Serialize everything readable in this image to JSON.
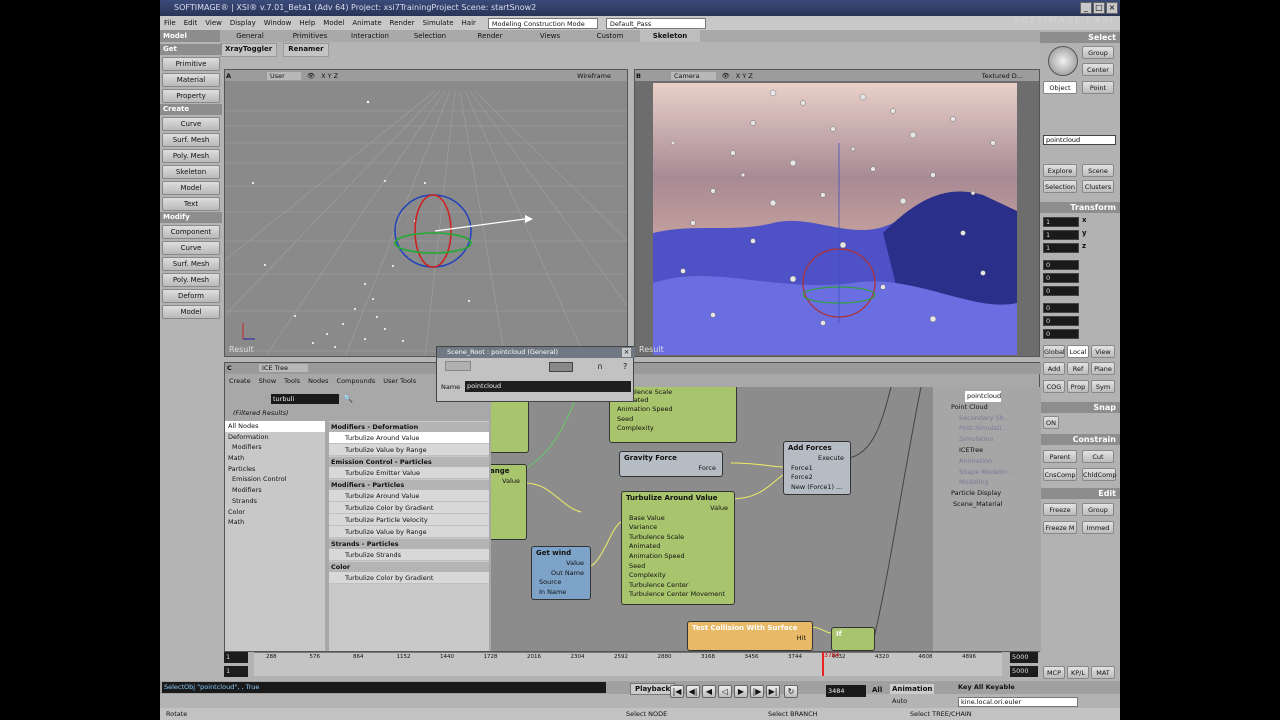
{
  "window": {
    "title": "SOFTIMAGE® | XSI® v.7.01_Beta1 (Adv 64) Project: xsi7TrainingProject     Scene: startSnow2",
    "brand": "SOFTIMAGE | XSI"
  },
  "menu": {
    "items": [
      "File",
      "Edit",
      "View",
      "Display",
      "Window",
      "Help",
      "Model",
      "Animate",
      "Render",
      "Simulate",
      "Hair"
    ],
    "layout": "Modeling Construction Mode",
    "pass": "Default_Pass"
  },
  "toptabs": {
    "mode": "Model",
    "tabs": [
      "General",
      "Primitives",
      "Interaction",
      "Selection",
      "Render",
      "Views",
      "Custom",
      "Skeleton"
    ]
  },
  "toolbar2": [
    "XrayToggler",
    "Renamer"
  ],
  "left": {
    "get": "Get",
    "get_items": [
      "Primitive",
      "Material",
      "Property"
    ],
    "create": "Create",
    "create_items": [
      "Curve",
      "Surf. Mesh",
      "Poly. Mesh",
      "Skeleton",
      "Model",
      "Text"
    ],
    "modify": "Modify",
    "modify_items": [
      "Component",
      "Curve",
      "Surf. Mesh",
      "Poly. Mesh",
      "Deform",
      "Model"
    ]
  },
  "vp1": {
    "letter": "A",
    "camera": "User",
    "axes": "X Y Z",
    "mode": "Wireframe",
    "result": "Result"
  },
  "vp2": {
    "letter": "B",
    "camera": "Camera",
    "axes": "X Y Z",
    "mode": "Textured D...",
    "result": "Result"
  },
  "right": {
    "select": "Select",
    "group": "Group",
    "center": "Center",
    "object": "Object",
    "point": "Point",
    "field": "pointcloud",
    "explore": "Explore",
    "scene": "Scene",
    "selection": "Selection",
    "clusters": "Clusters",
    "transform": "Transform",
    "axes": [
      "x",
      "y",
      "z"
    ],
    "scale_vals": [
      "1",
      "1",
      "1"
    ],
    "rot_vals": [
      "0",
      "0",
      "0"
    ],
    "trans_vals": [
      "0",
      "0",
      "0"
    ],
    "global": "Global",
    "local": "Local",
    "view": "View",
    "add": "Add",
    "ref": "Ref",
    "plane": "Plane",
    "cog": "COG",
    "prop": "Prop",
    "sym": "Sym",
    "snap": "Snap",
    "on": "ON",
    "constrain": "Constrain",
    "parent": "Parent",
    "cut": "Cut",
    "cnscomp": "CnsComp",
    "childcomp": "ChldComp",
    "edit": "Edit",
    "freeze": "Freeze",
    "egroup": "Group",
    "freezem": "Freeze M",
    "immed": "Immed"
  },
  "ice": {
    "letter": "C",
    "title": "ICE Tree",
    "menu": [
      "Create",
      "Show",
      "Tools",
      "Nodes",
      "Compounds",
      "User Tools"
    ],
    "search": "turbuli",
    "filtered": "(Filtered Results)",
    "cats": [
      {
        "label": "All Nodes",
        "sub": false,
        "sel": true
      },
      {
        "label": "Deformation",
        "sub": false,
        "sel": false
      },
      {
        "label": "Modifiers",
        "sub": true,
        "sel": false
      },
      {
        "label": "Math",
        "sub": false,
        "sel": false
      },
      {
        "label": "Particles",
        "sub": false,
        "sel": false
      },
      {
        "label": "Emission Control",
        "sub": true,
        "sel": false
      },
      {
        "label": "Modifiers",
        "sub": true,
        "sel": false
      },
      {
        "label": "Strands",
        "sub": true,
        "sel": false
      },
      {
        "label": "Color",
        "sub": false,
        "sel": false
      },
      {
        "label": "Math",
        "sub": false,
        "sel": false
      }
    ],
    "groups": [
      {
        "head": "Modifiers - Deformation",
        "items": [
          "Turbulize Around Value",
          "Turbulize Value by Range"
        ]
      },
      {
        "head": "Emission Control - Particles",
        "items": [
          "Turbulize Emitter Value"
        ]
      },
      {
        "head": "Modifiers - Particles",
        "items": [
          "Turbulize Around Value",
          "Turbulize Color by Gradient",
          "Turbulize Particle Velocity",
          "Turbulize Value by Range"
        ]
      },
      {
        "head": "Strands - Particles",
        "items": [
          "Turbulize Strands"
        ]
      },
      {
        "head": "Color",
        "items": [
          "Turbulize Color by Gradient"
        ]
      }
    ],
    "nodes": {
      "top": {
        "ports": [
          "Turbulence Scale",
          "Animated",
          "Animation Speed",
          "Seed",
          "Complexity"
        ]
      },
      "range": {
        "title": "ange",
        "value": "Value"
      },
      "gravity": {
        "title": "Gravity Force",
        "out": "Force"
      },
      "add": {
        "title": "Add Forces",
        "exec": "Execute",
        "ports": [
          "Force1",
          "Force2",
          "New (Force1) ..."
        ]
      },
      "turb": {
        "title": "Turbulize Around Value",
        "out": "Value",
        "ports": [
          "Base Value",
          "Variance",
          "Turbulence Scale",
          "Animated",
          "Animation Speed",
          "Seed",
          "Complexity",
          "Turbulence Center",
          "Turbulence Center Movement"
        ]
      },
      "getwind": {
        "title": "Get wind",
        "ports": [
          "Value",
          "Out Name"
        ],
        "in": [
          "Source",
          "In Name"
        ]
      },
      "collide": {
        "title": "Test Collision With Surface",
        "hit": "Hit"
      },
      "if": {
        "title": "If"
      }
    },
    "outliner": [
      "pointcloud",
      "Point Cloud",
      "Secondary Sh...",
      "Post-Simulati...",
      "Simulation",
      "ICETree",
      "Animation",
      "Shape Modelin...",
      "Modeling",
      "Particle Display",
      "Scene_Material"
    ]
  },
  "dialog": {
    "title": "Scene_Root : pointcloud (General)",
    "name_label": "Name",
    "name_value": "pointcloud"
  },
  "timeline": {
    "start": "1",
    "end": "5000",
    "ticks": [
      "288",
      "576",
      "864",
      "1152",
      "1440",
      "1728",
      "2016",
      "2304",
      "2592",
      "2880",
      "3168",
      "3456",
      "3744",
      "4032",
      "4320",
      "4608",
      "4896"
    ],
    "current": "3484",
    "current_marker": "3784",
    "end_a": "5000",
    "end_b": "5000"
  },
  "cmd": {
    "line": "SelectObj \"pointcloud\", , True",
    "playback": "Playback",
    "frame": "3484",
    "all": "All",
    "animation": "Animation",
    "key": "Key All Keyable",
    "auto": "Auto",
    "euler": "kine.local.ori.euler",
    "mcp": "MCP",
    "kpl": "KP/L",
    "mat": "MAT"
  },
  "status": {
    "mode": "Rotate",
    "s1": "Select NODE",
    "s2": "Select BRANCH",
    "s3": "Select TREE/CHAIN"
  }
}
